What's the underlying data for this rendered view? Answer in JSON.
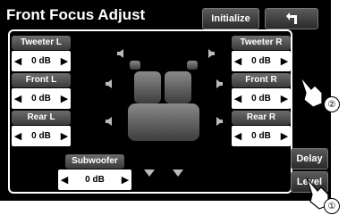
{
  "header": {
    "title": "Front Focus Adjust",
    "initialize_label": "Initialize"
  },
  "icons": {
    "back": "back-arrow-icon",
    "speaker": "speaker-icon",
    "hand": "finger-pointer-icon"
  },
  "channels": {
    "tweeter_l": {
      "label": "Tweeter L",
      "value": "0 dB"
    },
    "tweeter_r": {
      "label": "Tweeter R",
      "value": "0 dB"
    },
    "front_l": {
      "label": "Front L",
      "value": "0 dB"
    },
    "front_r": {
      "label": "Front R",
      "value": "0 dB"
    },
    "rear_l": {
      "label": "Rear L",
      "value": "0 dB"
    },
    "rear_r": {
      "label": "Rear R",
      "value": "0 dB"
    },
    "subwoofer": {
      "label": "Subwoofer",
      "value": "0 dB"
    }
  },
  "side": {
    "delay_label": "Delay",
    "level_label": "Level"
  },
  "callouts": {
    "one": "①",
    "two": "②"
  }
}
